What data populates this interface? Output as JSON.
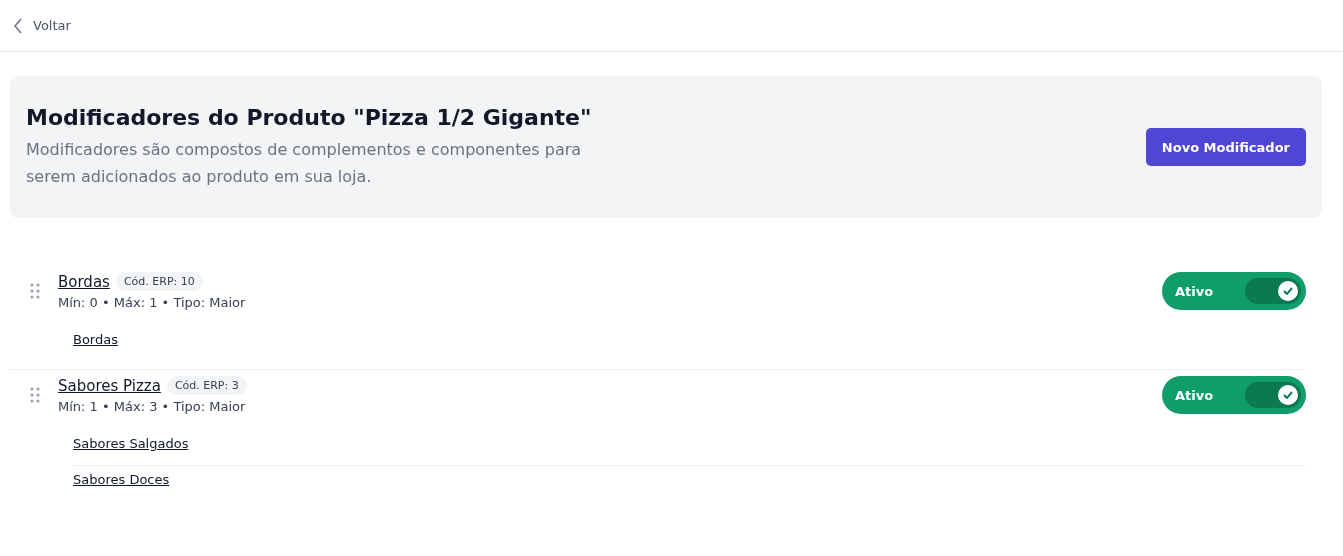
{
  "back": {
    "label": "Voltar"
  },
  "header": {
    "title": "Modificadores do Produto \"Pizza 1/2 Gigante\"",
    "description": "Modificadores são compostos de complementos e componentes para serem adicionados ao produto em sua loja.",
    "button": "Novo Modificador"
  },
  "modifiers": [
    {
      "name": "Bordas",
      "erp": "Cód. ERP: 10",
      "meta": "Mín: 0 • Máx: 1 • Tipo: Maior",
      "status": "Ativo",
      "on": true,
      "items": [
        "Bordas"
      ]
    },
    {
      "name": "Sabores Pizza",
      "erp": "Cód. ERP: 3",
      "meta": "Mín: 1 • Máx: 3 • Tipo: Maior",
      "status": "Ativo",
      "on": true,
      "items": [
        "Sabores Salgados",
        "Sabores Doces"
      ]
    }
  ]
}
